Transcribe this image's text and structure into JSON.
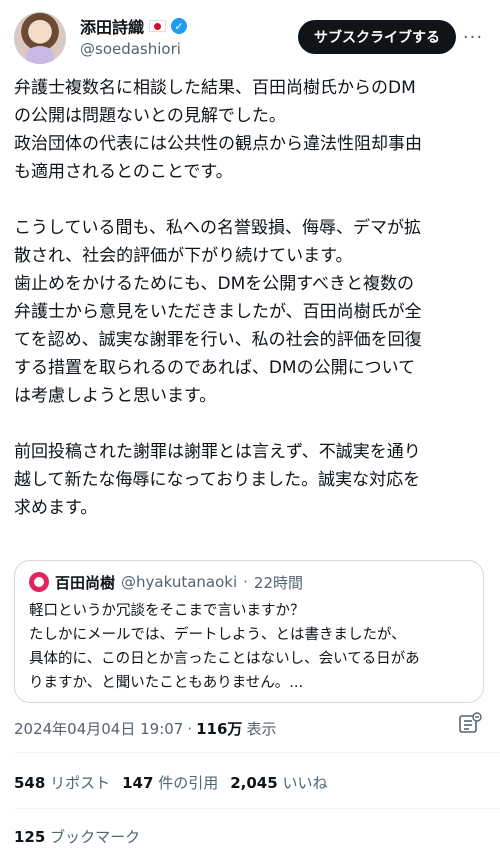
{
  "author": {
    "name": "添田詩織",
    "handle": "@soedashiori"
  },
  "subscribe_label": "サブスクライブする",
  "more_label": "···",
  "post": {
    "paragraphs": [
      "弁護士複数名に相談した結果、百田尚樹氏からのDM\nの公開は問題ないとの見解でした。\n政治団体の代表には公共性の観点から違法性阻却事由\nも適用されるとのことです。",
      "こうしている間も、私への名誉毀損、侮辱、デマが拡\n散され、社会的評価が下がり続けています。\n歯止めをかけるためにも、DMを公開すべきと複数の\n弁護士から意見をいただきましたが、百田尚樹氏が全\nてを認め、誠実な謝罪を行い、私の社会的評価を回復\nする措置を取られるのであれば、DMの公開について\nは考慮しようと思います。",
      "前回投稿された謝罪は謝罪とは言えず、不誠実を通り\n越して新たな侮辱になっておりました。誠実な対応を\n求めます。"
    ]
  },
  "quote": {
    "name": "百田尚樹",
    "handle": "@hyakutanaoki",
    "time": "22時間",
    "lines": [
      "軽口というか冗談をそこまで言いますか？",
      "たしかにメールでは、デートしよう、とは書きましたが、",
      "具体的に、この日とか言ったことはないし、会いてる日があ",
      "りますか、と聞いたこともありません。..."
    ]
  },
  "meta": {
    "datetime": "2024年04月04日 19:07",
    "separator": "·",
    "views": "116万",
    "views_label": "表示"
  },
  "stats": {
    "reposts": "548",
    "reposts_label": "リポスト",
    "quotes": "147",
    "quotes_label": "件の引用",
    "likes": "2,045",
    "likes_label": "いいね",
    "bookmarks": "125",
    "bookmarks_label": "ブックマーク"
  },
  "colors": {
    "accent": "#1d9bf0",
    "text": "#0f1419",
    "muted": "#536471"
  }
}
